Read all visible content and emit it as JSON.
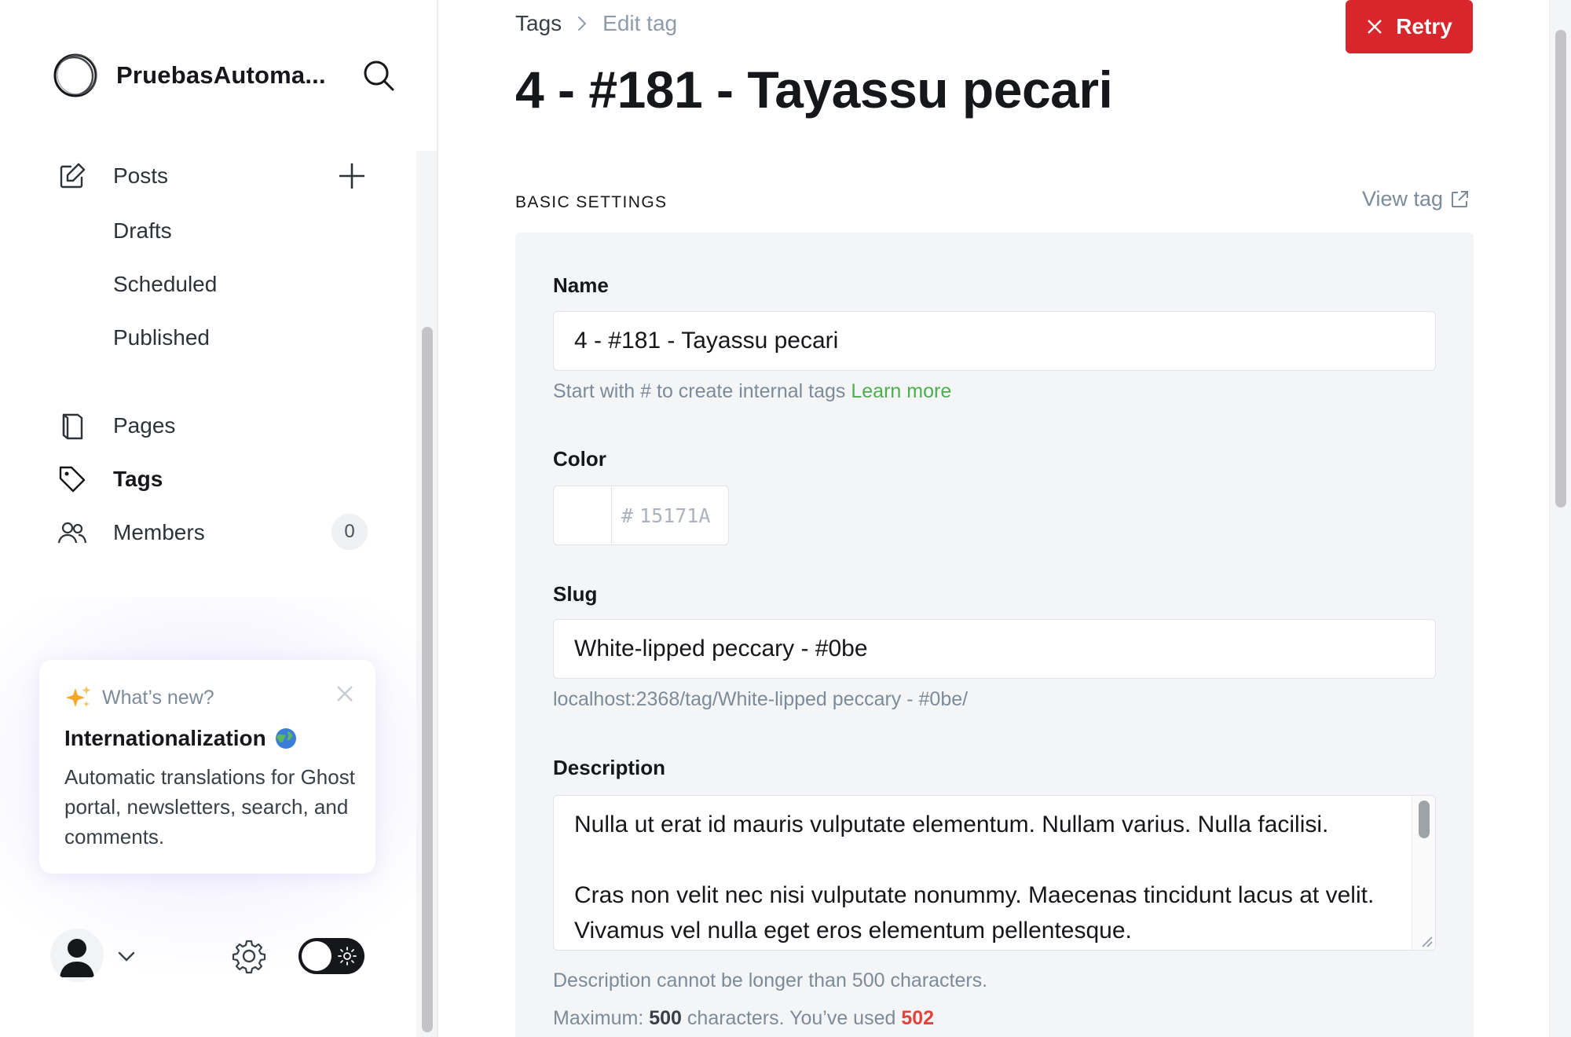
{
  "sidebar": {
    "site_title": "PruebasAutoma...",
    "nav": {
      "posts": "Posts",
      "drafts": "Drafts",
      "scheduled": "Scheduled",
      "published": "Published",
      "pages": "Pages",
      "tags": "Tags",
      "members": "Members",
      "members_count": "0"
    },
    "whats_new": {
      "heading": "What’s new?",
      "title": "Internationalization",
      "body": "Automatic translations for Ghost portal, newsletters, search, and comments."
    }
  },
  "header": {
    "breadcrumb_root": "Tags",
    "breadcrumb_current": "Edit tag",
    "retry_label": "Retry",
    "page_title": "4 - #181 - Tayassu pecari"
  },
  "basic_settings": {
    "section_label": "BASIC SETTINGS",
    "view_tag_label": "View tag",
    "name": {
      "label": "Name",
      "value": "4 - #181 - Tayassu pecari",
      "hint": "Start with # to create internal tags",
      "learn_more": "Learn more"
    },
    "color": {
      "label": "Color",
      "hash": "#",
      "value": "15171A"
    },
    "slug": {
      "label": "Slug",
      "value": "White-lipped peccary - #0be",
      "url_preview": "localhost:2368/tag/White-lipped peccary - #0be/"
    },
    "description": {
      "label": "Description",
      "value": "Nulla ut erat id mauris vulputate elementum. Nullam varius. Nulla facilisi.\n\nCras non velit nec nisi vulputate nonummy. Maecenas tincidunt lacus at velit. Vivamus vel nulla eget eros elementum pellentesque.",
      "limit_hint": "Description cannot be longer than 500 characters.",
      "max_prefix": "Maximum:",
      "max_value": "500",
      "used_prefix": "characters. You’ve used",
      "used_value": "502"
    }
  },
  "colors": {
    "accent_red": "#d9262c",
    "learn_more_green": "#4cae4f",
    "over_limit": "#e0443a"
  }
}
